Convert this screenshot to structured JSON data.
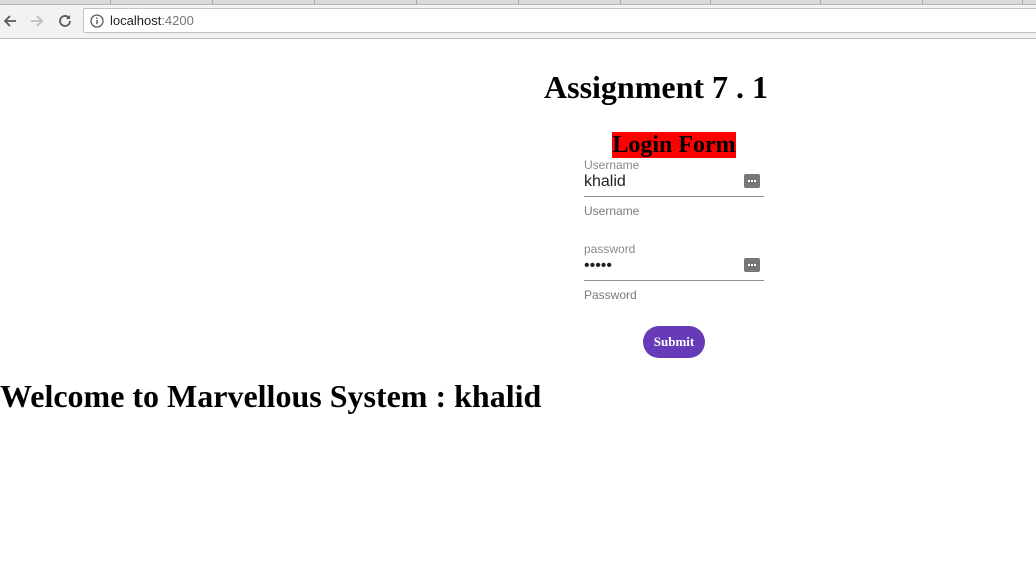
{
  "browser": {
    "url_host": "localhost",
    "url_port": ":4200",
    "icons": {
      "back": "back-arrow-icon",
      "forward": "forward-arrow-icon",
      "reload": "reload-icon",
      "info": "info-icon"
    }
  },
  "page": {
    "title": "Assignment 7 . 1",
    "form_heading": "Login Form",
    "form_heading_bg": "#ff0000",
    "username": {
      "label": "Username",
      "value": "khalid",
      "hint": "Username"
    },
    "password": {
      "label": "password",
      "value": "khali",
      "hint": "Password"
    },
    "submit_label": "Submit",
    "submit_color": "#673ab7",
    "welcome": "Welcome to Marvellous System : khalid"
  }
}
